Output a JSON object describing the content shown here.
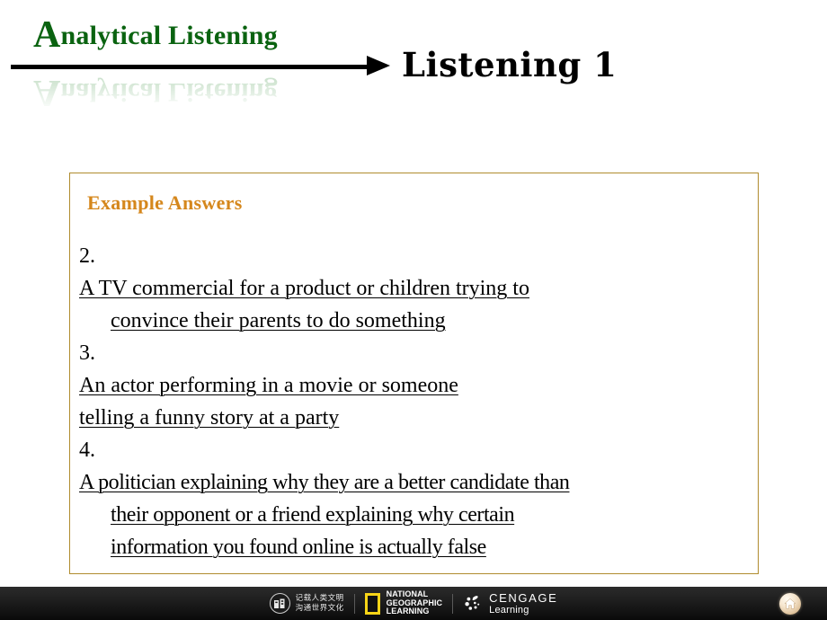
{
  "header": {
    "brand_cap": "A",
    "brand_rest": "nalytical Listening",
    "slide_title": "Listening 1",
    "arrow_icon": "right-arrow-icon",
    "brand_color": "#0a6310",
    "reflection_color": "#58a05c"
  },
  "content": {
    "heading": "Example Answers",
    "heading_color": "#d5871c",
    "border_color": "#b08c2e",
    "answers": [
      {
        "number": "2.",
        "lines": [
          "A TV commercial for a product or children trying to",
          "convince their parents to do something"
        ]
      },
      {
        "number": "3.",
        "lines": [
          "An actor performing in a movie or someone",
          "telling a funny story at a party"
        ]
      },
      {
        "number": "4.",
        "lines": [
          "A politician explaining why they are a better candidate than",
          "their opponent or a friend explaining why certain",
          "information you found online is actually false"
        ]
      }
    ]
  },
  "footer": {
    "seal_line1": "记载人类文明",
    "seal_line2": "沟通世界文化",
    "natgeo_line1": "NATIONAL",
    "natgeo_line2": "GEOGRAPHIC",
    "natgeo_line3": "LEARNING",
    "natgeo_accent": "#f7d417",
    "cengage_name": "CENGAGE",
    "cengage_sub": "Learning",
    "home_icon": "home-icon",
    "bar_color": "#1d1d1d"
  }
}
